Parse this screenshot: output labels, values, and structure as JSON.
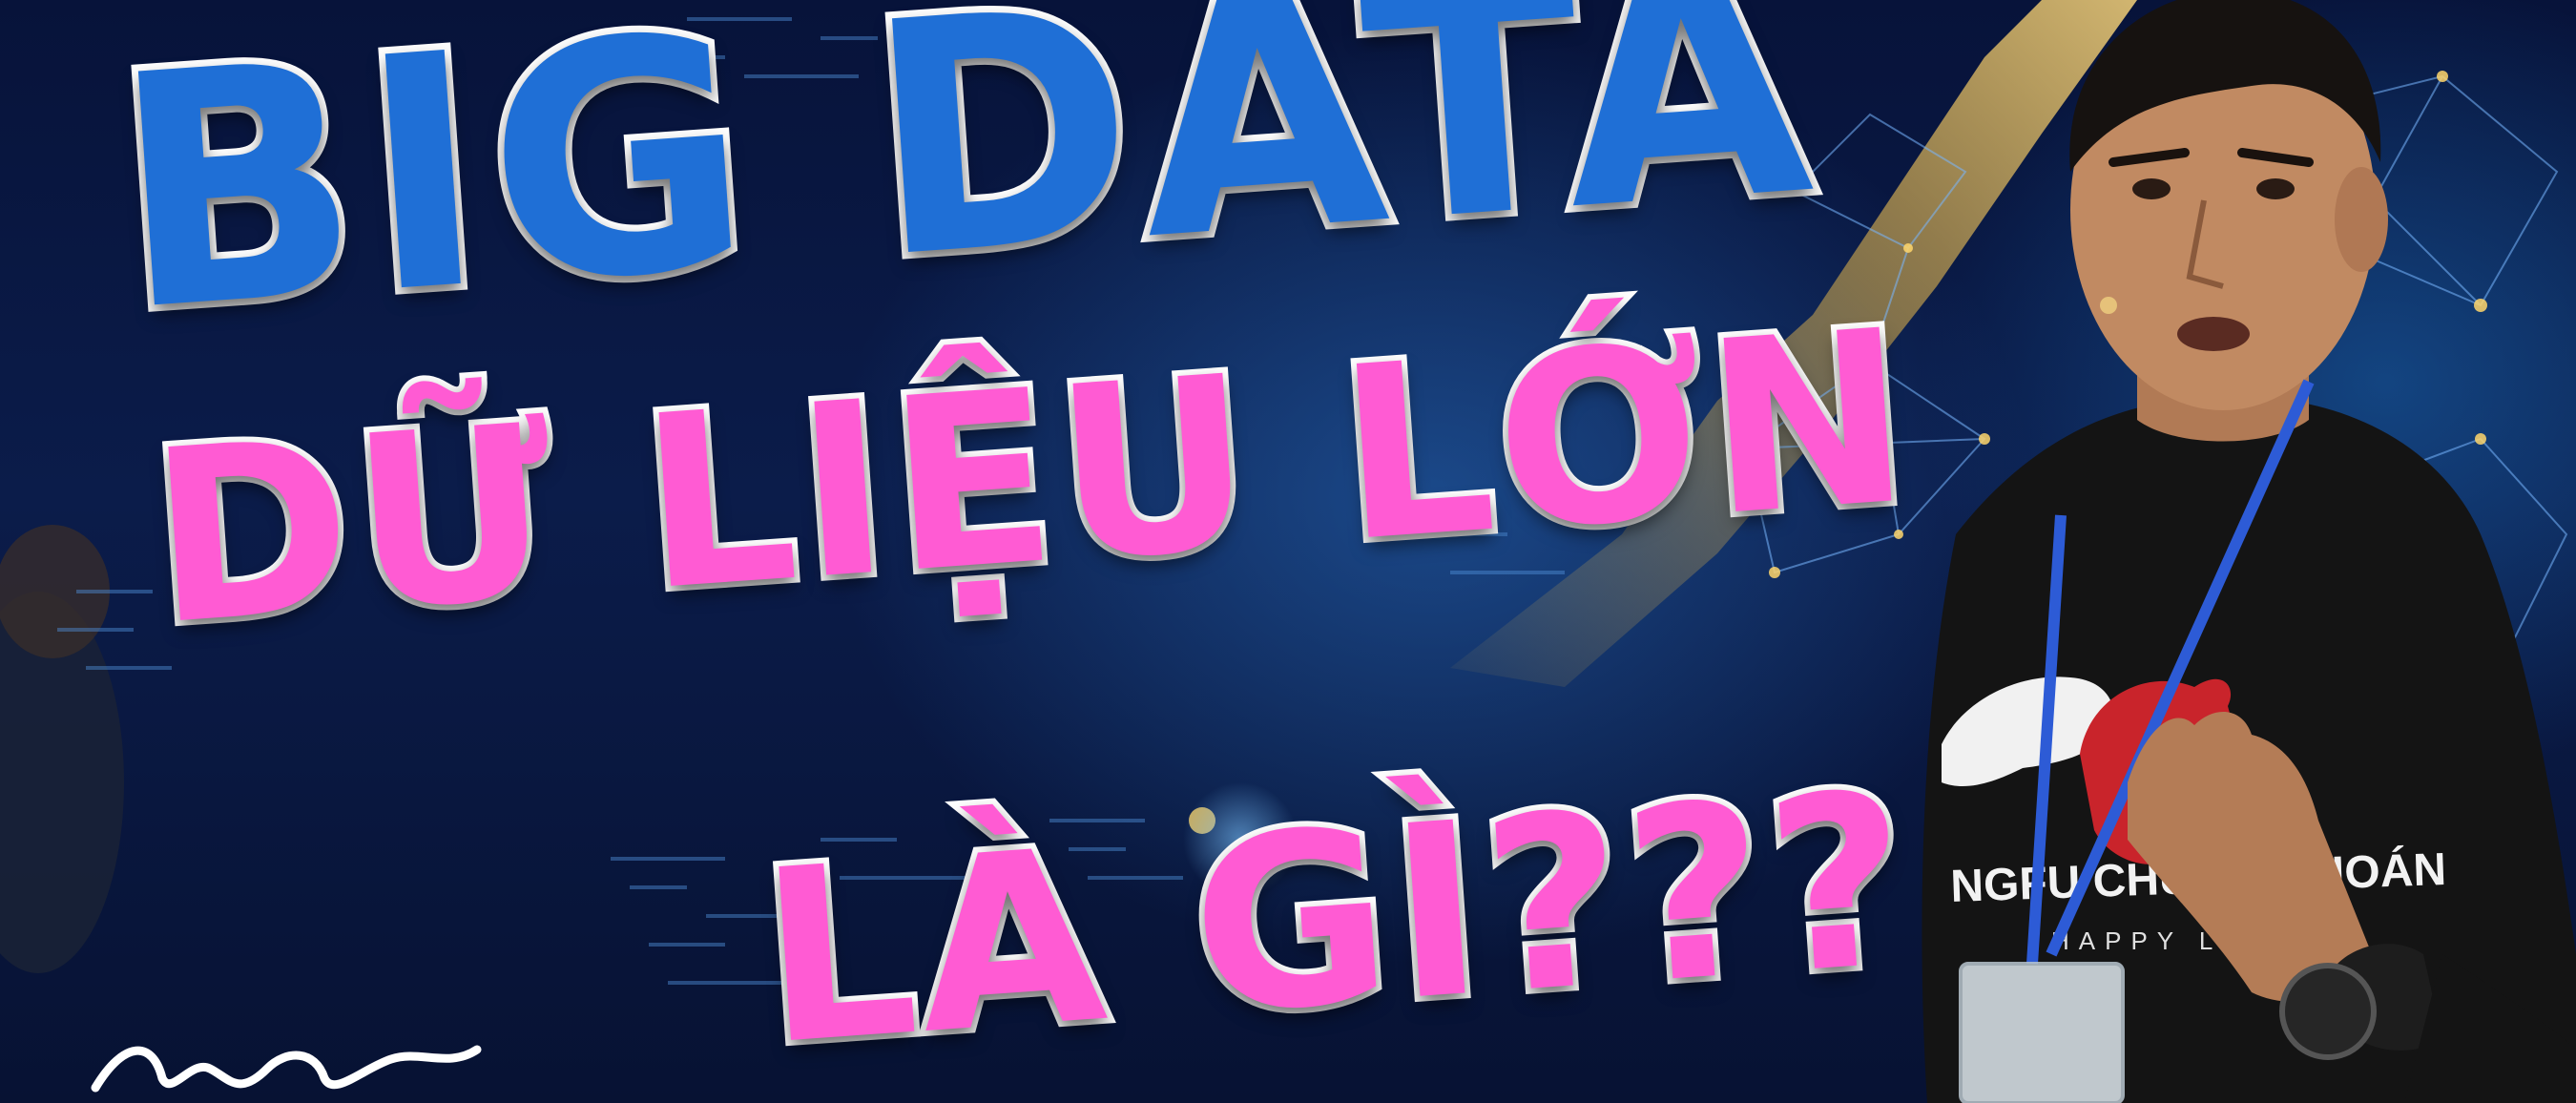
{
  "title": {
    "line1": "BIG DATA",
    "line2": "DỮ LIỆU LỚN",
    "line3": "LÀ GÌ???"
  },
  "shirt_print": {
    "brand": "NGFU CHỨNG KHOÁN",
    "tagline": "HAPPY LIVE"
  },
  "colors": {
    "title_blue": "#1f6fd6",
    "title_pink": "#ff5bd3",
    "outline": "#ffffff",
    "background_navy": "#071233",
    "gold_accent": "#e7b84a"
  },
  "icons": {
    "bull": "bull-icon",
    "bear": "bear-icon",
    "lanyard": "lanyard"
  }
}
